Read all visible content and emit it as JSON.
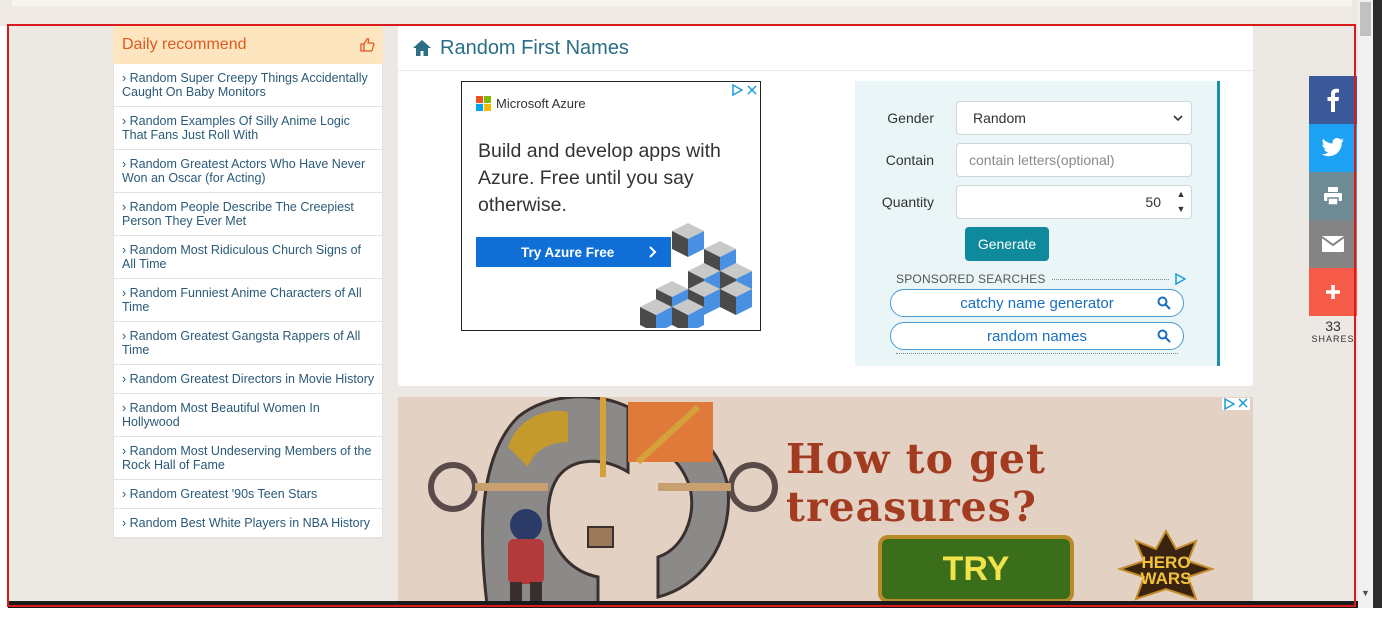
{
  "sidebar": {
    "title": "Daily recommend",
    "thumb_icon": "thumbs-up-icon",
    "items": [
      {
        "label": "Random Super Creepy Things Accidentally Caught On Baby Monitors"
      },
      {
        "label": "Random Examples Of Silly Anime Logic That Fans Just Roll With"
      },
      {
        "label": "Random Greatest Actors Who Have Never Won an Oscar (for Acting)"
      },
      {
        "label": "Random People Describe The Creepiest Person They Ever Met"
      },
      {
        "label": "Random Most Ridiculous Church Signs of All Time"
      },
      {
        "label": "Random Funniest Anime Characters of All Time"
      },
      {
        "label": "Random Greatest Gangsta Rappers of All Time"
      },
      {
        "label": "Random Greatest Directors in Movie History"
      },
      {
        "label": "Random Most Beautiful Women In Hollywood"
      },
      {
        "label": "Random Most Undeserving Members of the Rock Hall of Fame"
      },
      {
        "label": "Random Greatest '90s Teen Stars"
      },
      {
        "label": "Random Best White Players in NBA History"
      }
    ]
  },
  "main": {
    "title": "Random First Names",
    "home_icon": "home-icon"
  },
  "azure_ad": {
    "brand": "Microsoft Azure",
    "headline": "Build and develop apps with Azure. Free until you say otherwise.",
    "cta": "Try Azure Free"
  },
  "generator": {
    "gender_label": "Gender",
    "gender_value": "Random",
    "contain_label": "Contain",
    "contain_placeholder": "contain letters(optional)",
    "quantity_label": "Quantity",
    "quantity_value": "50",
    "generate_label": "Generate",
    "sponsored_label": "SPONSORED SEARCHES",
    "searches": [
      "catchy name generator",
      "random names"
    ]
  },
  "game_ad": {
    "headline": "How to get treasures?",
    "cta": "TRY",
    "brand_line1": "HERO",
    "brand_line2": "WARS"
  },
  "share": {
    "count": "33",
    "label": "SHARES",
    "buttons": [
      {
        "name": "facebook-share-button",
        "icon": "facebook-icon",
        "color": "#3b5998"
      },
      {
        "name": "twitter-share-button",
        "icon": "twitter-icon",
        "color": "#1da1f2"
      },
      {
        "name": "print-share-button",
        "icon": "print-icon",
        "color": "#6d8a95"
      },
      {
        "name": "email-share-button",
        "icon": "email-icon",
        "color": "#848484"
      },
      {
        "name": "more-share-button",
        "icon": "plus-icon",
        "color": "#f65b49"
      }
    ]
  },
  "colors": {
    "accent_teal": "#0e8a9c",
    "title_teal": "#2b6e86",
    "recommend_orange": "#e0591f"
  }
}
